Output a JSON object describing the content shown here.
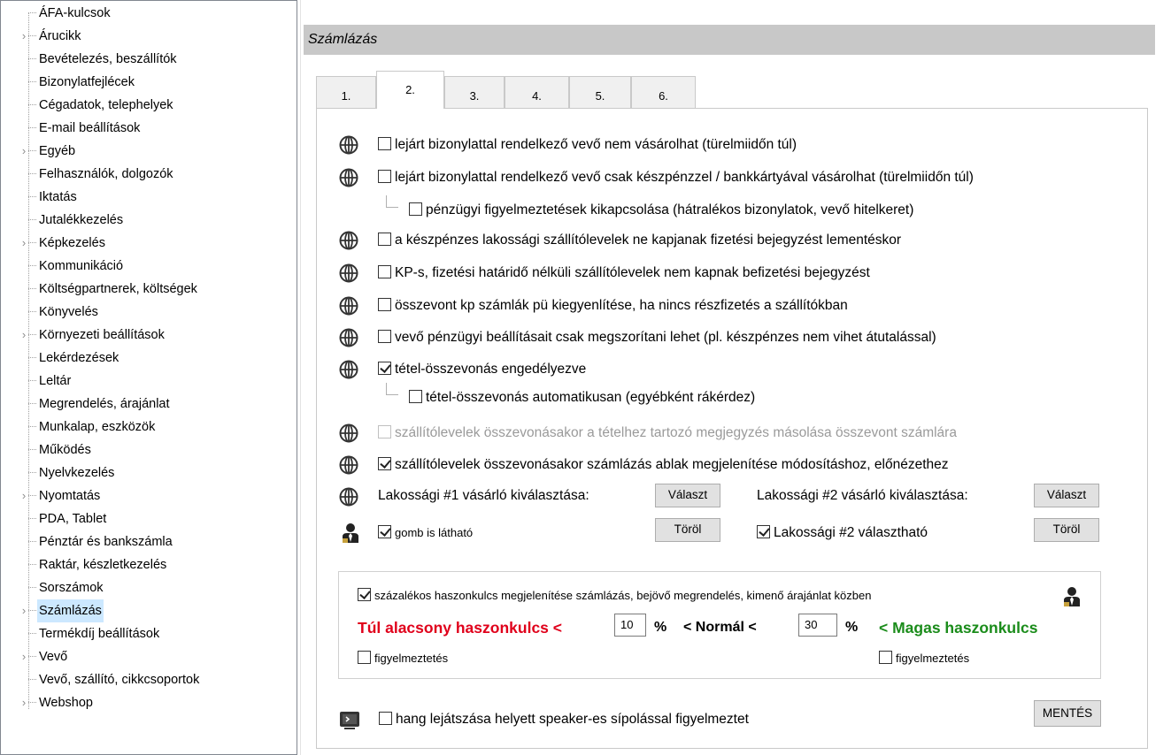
{
  "sidebar": {
    "items": [
      {
        "label": "ÁFA-kulcsok",
        "expandable": false
      },
      {
        "label": "Árucikk",
        "expandable": true
      },
      {
        "label": "Bevételezés, beszállítók",
        "expandable": false
      },
      {
        "label": "Bizonylatfejlécek",
        "expandable": false
      },
      {
        "label": "Cégadatok, telephelyek",
        "expandable": false
      },
      {
        "label": "E-mail beállítások",
        "expandable": false
      },
      {
        "label": "Egyéb",
        "expandable": true
      },
      {
        "label": "Felhasználók, dolgozók",
        "expandable": false
      },
      {
        "label": "Iktatás",
        "expandable": false
      },
      {
        "label": "Jutalékkezelés",
        "expandable": false
      },
      {
        "label": "Képkezelés",
        "expandable": true
      },
      {
        "label": "Kommunikáció",
        "expandable": false
      },
      {
        "label": "Költségpartnerek, költségek",
        "expandable": false
      },
      {
        "label": "Könyvelés",
        "expandable": false
      },
      {
        "label": "Környezeti beállítások",
        "expandable": true
      },
      {
        "label": "Lekérdezések",
        "expandable": false
      },
      {
        "label": "Leltár",
        "expandable": false
      },
      {
        "label": "Megrendelés, árajánlat",
        "expandable": false
      },
      {
        "label": "Munkalap, eszközök",
        "expandable": false
      },
      {
        "label": "Működés",
        "expandable": false
      },
      {
        "label": "Nyelvkezelés",
        "expandable": false
      },
      {
        "label": "Nyomtatás",
        "expandable": true
      },
      {
        "label": "PDA, Tablet",
        "expandable": false
      },
      {
        "label": "Pénztár és bankszámla",
        "expandable": false
      },
      {
        "label": "Raktár, készletkezelés",
        "expandable": false
      },
      {
        "label": "Sorszámok",
        "expandable": false
      },
      {
        "label": "Számlázás",
        "expandable": true,
        "selected": true
      },
      {
        "label": "Termékdíj beállítások",
        "expandable": false
      },
      {
        "label": "Vevő",
        "expandable": true
      },
      {
        "label": "Vevő, szállító, cikkcsoportok",
        "expandable": false
      },
      {
        "label": "Webshop",
        "expandable": true
      }
    ]
  },
  "header": {
    "title": "Számlázás"
  },
  "tabs": [
    "1.",
    "2.",
    "3.",
    "4.",
    "5.",
    "6."
  ],
  "active_tab": "2.",
  "options": {
    "o1": {
      "label": "lejárt bizonylattal rendelkező vevő nem vásárolhat (türelmiidőn túl)",
      "checked": false
    },
    "o2": {
      "label": "lejárt bizonylattal rendelkező vevő csak készpénzzel / bankkártyával vásárolhat (türelmiidőn túl)",
      "checked": false
    },
    "o2a": {
      "label": "pénzügyi figyelmeztetések kikapcsolása (hátralékos bizonylatok, vevő hitelkeret)",
      "checked": false
    },
    "o3": {
      "label": "a készpénzes lakossági szállítólevelek ne kapjanak fizetési bejegyzést lementéskor",
      "checked": false
    },
    "o4": {
      "label": "KP-s, fizetési határidő nélküli szállítólevelek nem kapnak befizetési bejegyzést",
      "checked": false
    },
    "o5": {
      "label": "összevont kp számlák pü kiegyenlítése, ha nincs részfizetés a szállítókban",
      "checked": false
    },
    "o6": {
      "label": "vevő pénzügyi beállításait csak megszorítani lehet  (pl. készpénzes nem vihet átutalással)",
      "checked": false
    },
    "o7": {
      "label": "tétel-összevonás engedélyezve",
      "checked": true
    },
    "o7a": {
      "label": "tétel-összevonás automatikusan (egyébként rákérdez)",
      "checked": false
    },
    "o8": {
      "label": "szállítólevelek összevonásakor a tételhez tartozó megjegyzés másolása összevont számlára",
      "checked": false,
      "disabled": true
    },
    "o9": {
      "label": "szállítólevelek összevonásakor számlázás ablak megjelenítése módosításhoz, előnézethez",
      "checked": true
    }
  },
  "lakossagi": {
    "l1_label": "Lakossági #1 vásárló kiválasztása:",
    "l2_label": "Lakossági #2 vásárló kiválasztása:",
    "choose_btn": "Választ",
    "delete_btn": "Töröl",
    "gomb_label": "gomb is látható",
    "gomb_checked": true,
    "l2_selectable_label": "Lakossági #2 választható",
    "l2_selectable_checked": true
  },
  "margin": {
    "show_label": "százalékos haszonkulcs megjelenítése számlázás, bejövő megrendelés, kimenő árajánlat közben",
    "show_checked": true,
    "low_label": "Túl alacsony haszonkulcs <",
    "low_value": "10",
    "pct": "%",
    "normal_label": "< Normál <",
    "high_value": "30",
    "high_label": "< Magas haszonkulcs",
    "warn_label": "figyelmeztetés"
  },
  "sound": {
    "label": "hang lejátszása helyett speaker-es sípolással figyelmeztet",
    "checked": false
  },
  "save_button": "MENTÉS",
  "colors": {
    "low": "#e0001b",
    "high": "#1b8c1b",
    "header_bg": "#c8c8c8",
    "selected": "#cce8ff"
  }
}
